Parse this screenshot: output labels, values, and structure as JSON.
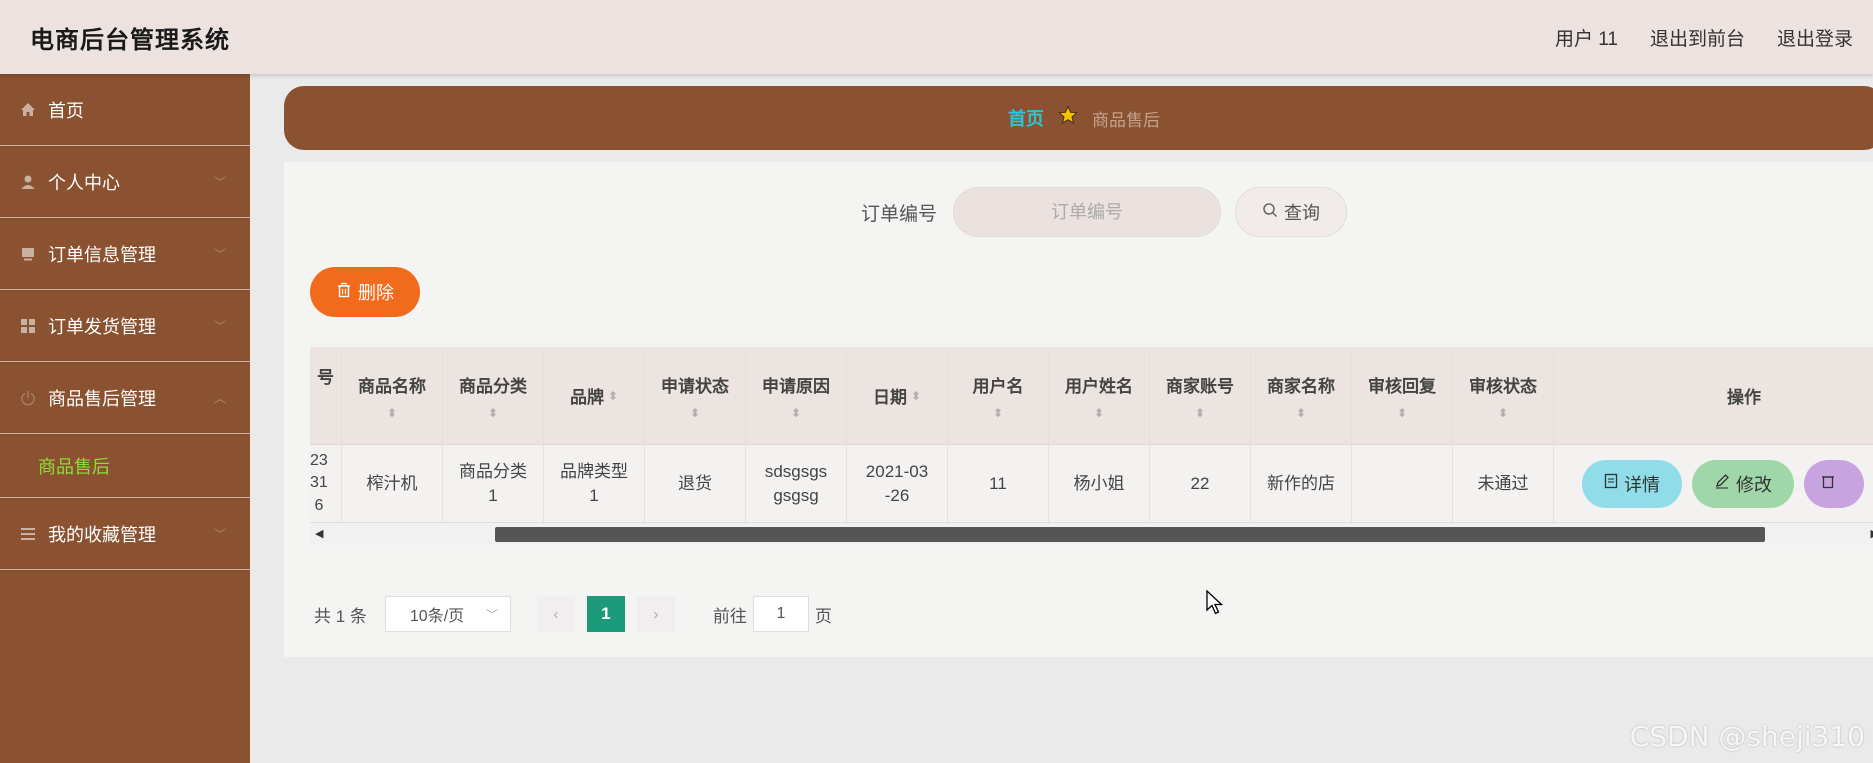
{
  "header": {
    "app_title": "电商后台管理系统",
    "user_label": "用户 11",
    "exit_front": "退出到前台",
    "logout": "退出登录"
  },
  "sidebar": {
    "items": [
      {
        "label": "首页",
        "icon": "home-icon"
      },
      {
        "label": "个人中心",
        "icon": "user-icon"
      },
      {
        "label": "订单信息管理",
        "icon": "monitor-icon"
      },
      {
        "label": "订单发货管理",
        "icon": "grid-icon"
      },
      {
        "label": "商品售后管理",
        "icon": "power-icon"
      },
      {
        "label": "我的收藏管理",
        "icon": "menu-icon"
      }
    ],
    "active_sub": "商品售后"
  },
  "breadcrumb": {
    "home": "首页",
    "current": "商品售后",
    "star_color": "#f3c200"
  },
  "search": {
    "label": "订单编号",
    "placeholder": "订单编号",
    "button": "查询"
  },
  "toolbar": {
    "delete_label": "删除"
  },
  "table": {
    "columns": [
      "号",
      "商品名称",
      "商品分类",
      "品牌",
      "申请状态",
      "申请原因",
      "日期",
      "用户名",
      "用户姓名",
      "商家账号",
      "商家名称",
      "审核回复",
      "审核状态",
      "操作"
    ],
    "row": {
      "order_no": "23\n31\n6",
      "product_name": "榨汁机",
      "category": "商品分类\n1",
      "brand": "品牌类型\n1",
      "apply_status": "退货",
      "apply_reason": "sdsgsgs\ngsgsg",
      "date": "2021-03\n-26",
      "username": "11",
      "user_realname": "杨小姐",
      "merchant_account": "22",
      "merchant_name": "新作的店",
      "audit_reply": "",
      "audit_status": "未通过"
    },
    "actions": {
      "detail": "详情",
      "edit": "修改"
    }
  },
  "pagination": {
    "total": "共 1 条",
    "page_size": "10条/页",
    "current_page": "1",
    "goto_label": "前往",
    "goto_value": "1",
    "page_suffix": "页"
  },
  "watermark": "CSDN @sheji310",
  "colors": {
    "sidebar": "#8a5230",
    "active_sub": "#8ddc3a",
    "delete_button": "#f26a1c",
    "current_page": "#1a9a78"
  }
}
